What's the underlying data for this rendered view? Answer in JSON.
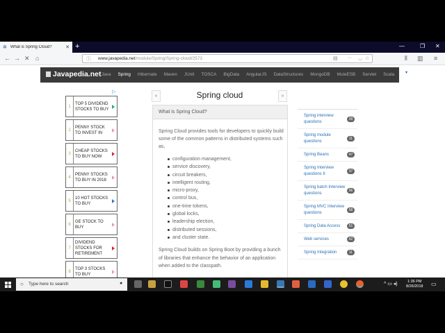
{
  "browser": {
    "tab_title": "What is Spring Cloud?",
    "url_host": "www.javapedia.net",
    "url_path": "/module/Spring/Spring-cloud/2573"
  },
  "site": {
    "logo": "Javapedia.net",
    "menu": [
      "Java",
      "Spring",
      "Hibernate",
      "Maven",
      "JUnit",
      "TOSCA",
      "BigData",
      "AngularJS",
      "DataStructures",
      "MongoDB",
      "MuleESB",
      "Servlet",
      "Scala"
    ],
    "active_menu": "Spring"
  },
  "ads": [
    {
      "num": "1",
      "text": "TOP 5 DIVIDEND STOCKS TO BUY"
    },
    {
      "num": "2",
      "text": "PENNY STOCK TO INVEST IN"
    },
    {
      "num": "3",
      "text": "CHEAP STOCKS TO BUY NOW"
    },
    {
      "num": "4",
      "text": "PENNY STOCKS TO BUY IN 2018"
    },
    {
      "num": "5",
      "text": "10 HOT STOCKS TO BUY"
    },
    {
      "num": "6",
      "text": "GE STOCK TO BUY"
    },
    {
      "num": "7",
      "text": "DIVIDEND STOCKS FOR RETIREMENT"
    },
    {
      "num": "8",
      "text": "TOP 3 STOCKS TO BUY"
    }
  ],
  "article": {
    "title": "Spring cloud",
    "question": "What is Spring Cloud?",
    "intro": "Spring Cloud provides tools for developers to quickly build some of the common patterns in distributed systems such as,",
    "bullets": [
      "configuration management,",
      "service discovery,",
      "circuit breakers,",
      "intelligent routing,",
      "micro-proxy,",
      "control bus,",
      "one-time tokens,",
      "global locks,",
      "leadership election,",
      "distributed sessions,",
      "and cluster state."
    ],
    "outro": "Spring Cloud builds on Spring Boot by providing a bunch of libraries that enhance the behavior of an application when added to the classpath."
  },
  "sidebar": [
    {
      "label": "Spring interview questions",
      "count": "39"
    },
    {
      "label": "Spring module questions",
      "count": "11"
    },
    {
      "label": "Spring Beans",
      "count": "47"
    },
    {
      "label": "Spring Interview questions II",
      "count": "37"
    },
    {
      "label": "Spring batch Interview questions",
      "count": "56"
    },
    {
      "label": "Spring MVC Interview questions",
      "count": "58"
    },
    {
      "label": "Spring Data Access",
      "count": "51"
    },
    {
      "label": "Web services",
      "count": "62"
    },
    {
      "label": "Spring Integration",
      "count": "11"
    }
  ],
  "taskbar": {
    "search_placeholder": "Type here to search",
    "time": "1:36 PM",
    "date": "8/26/2018"
  }
}
